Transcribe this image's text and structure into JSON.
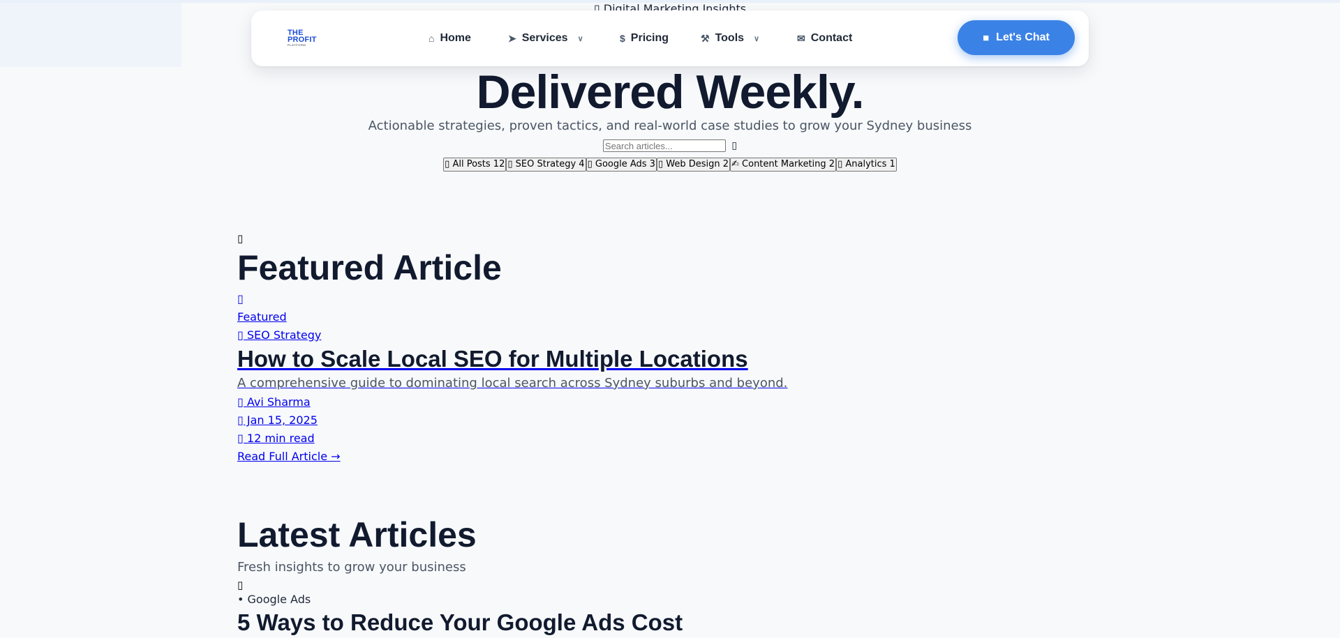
{
  "hero": {
    "eyebrow": "▯ Digital Marketing Insights",
    "title": "Delivered Weekly.",
    "subtitle": "Actionable strategies, proven tactics, and real-world case studies to grow your Sydney business",
    "search_placeholder": "Search articles...",
    "search_glyph": "▯"
  },
  "filters": [
    {
      "label": "▯ All Posts 12"
    },
    {
      "label": "▯ SEO Strategy 4"
    },
    {
      "label": "▯ Google Ads 3"
    },
    {
      "label": "▯ Web Design 2"
    },
    {
      "label": "✍ Content Marketing 2"
    },
    {
      "label": "▯ Analytics 1"
    }
  ],
  "nav": {
    "logo": {
      "line1": "THE",
      "line2": "PROFIT",
      "line3": "PLATFORM"
    },
    "items": [
      {
        "label": "Home",
        "icon": "home-icon",
        "glyph": "⌂"
      },
      {
        "label": "Services",
        "icon": "rocket-icon",
        "glyph": "➤"
      },
      {
        "label": "Pricing",
        "icon": "dollar-icon",
        "glyph": "$"
      },
      {
        "label": "Tools",
        "icon": "tools-icon",
        "glyph": "⚒"
      },
      {
        "label": "Contact",
        "icon": "envelope-icon",
        "glyph": "✉"
      }
    ],
    "chevron_glyph": "∨",
    "cta": {
      "label": "Let's Chat",
      "icon": "chat-icon",
      "glyph": "■"
    },
    "accent_color": "#3b82e6"
  },
  "featured": {
    "section_glyph": "▯",
    "heading": "Featured Article",
    "article_glyph": "▯",
    "badge": "Featured",
    "category": "▯ SEO Strategy",
    "title": "How to Scale Local SEO for Multiple Locations",
    "excerpt": "A comprehensive guide to dominating local search across Sydney suburbs and beyond.",
    "author": "▯ Avi Sharma",
    "date": "▯ Jan 15, 2025",
    "read_time": "▯ 12 min read",
    "cta": "Read Full Article →"
  },
  "latest": {
    "heading": "Latest Articles",
    "subheading": "Fresh insights to grow your business",
    "posts": [
      {
        "glyph": "▯",
        "category": "• Google Ads",
        "title": "5 Ways to Reduce Your Google Ads Cost"
      }
    ]
  }
}
